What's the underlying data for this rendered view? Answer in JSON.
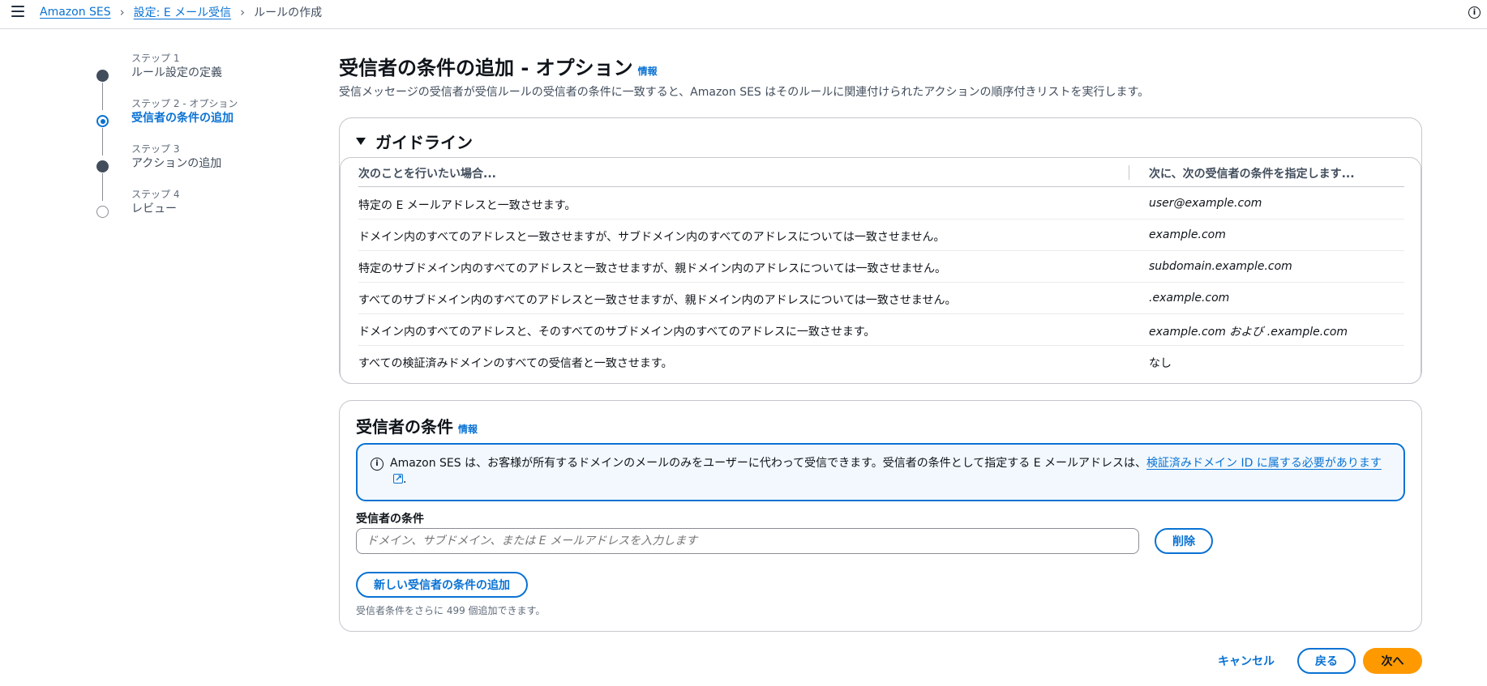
{
  "breadcrumb": {
    "items": [
      "Amazon SES",
      "設定: E メール受信"
    ],
    "current": "ルールの作成"
  },
  "steps": [
    {
      "small": "ステップ 1",
      "main": "ルール設定の定義"
    },
    {
      "small": "ステップ 2 - オプション",
      "main": "受信者の条件の追加"
    },
    {
      "small": "ステップ 3",
      "main": "アクションの追加"
    },
    {
      "small": "ステップ 4",
      "main": "レビュー"
    }
  ],
  "page": {
    "title": "受信者の条件の追加 - オプション",
    "info": "情報",
    "description": "受信メッセージの受信者が受信ルールの受信者の条件に一致すると、Amazon SES はそのルールに関連付けられたアクションの順序付きリストを実行します。"
  },
  "guidelines": {
    "title": "ガイドライン",
    "headers": [
      "次のことを行いたい場合...",
      "次に、次の受信者の条件を指定します..."
    ],
    "rows": [
      [
        "特定の E メールアドレスと一致させます。",
        "user@example.com"
      ],
      [
        "ドメイン内のすべてのアドレスと一致させますが、サブドメイン内のすべてのアドレスについては一致させません。",
        "example.com"
      ],
      [
        "特定のサブドメイン内のすべてのアドレスと一致させますが、親ドメイン内のアドレスについては一致させません。",
        "subdomain.example.com"
      ],
      [
        "すべてのサブドメイン内のすべてのアドレスと一致させますが、親ドメイン内のアドレスについては一致させません。",
        ".example.com"
      ],
      [
        "ドメイン内のすべてのアドレスと、そのすべてのサブドメイン内のすべてのアドレスに一致させます。",
        "example.com および .example.com"
      ],
      [
        "すべての検証済みドメインのすべての受信者と一致させます。",
        "なし"
      ]
    ]
  },
  "conditions": {
    "title": "受信者の条件",
    "info": "情報",
    "alert_text": "Amazon SES は、お客様が所有するドメインのメールのみをユーザーに代わって受信できます。受信者の条件として指定する E メールアドレスは、",
    "alert_link": "検証済みドメイン ID に属する必要があります",
    "alert_end": ".",
    "field_label": "受信者の条件",
    "field_placeholder": "ドメイン、サブドメイン、または E メールアドレスを入力します",
    "delete_label": "削除",
    "add_label": "新しい受信者の条件の追加",
    "hint": "受信者条件をさらに 499 個追加できます。"
  },
  "footer": {
    "cancel": "キャンセル",
    "back": "戻る",
    "next": "次へ"
  },
  "colors": {
    "link": "#0972d3",
    "primary": "#ff9900"
  }
}
